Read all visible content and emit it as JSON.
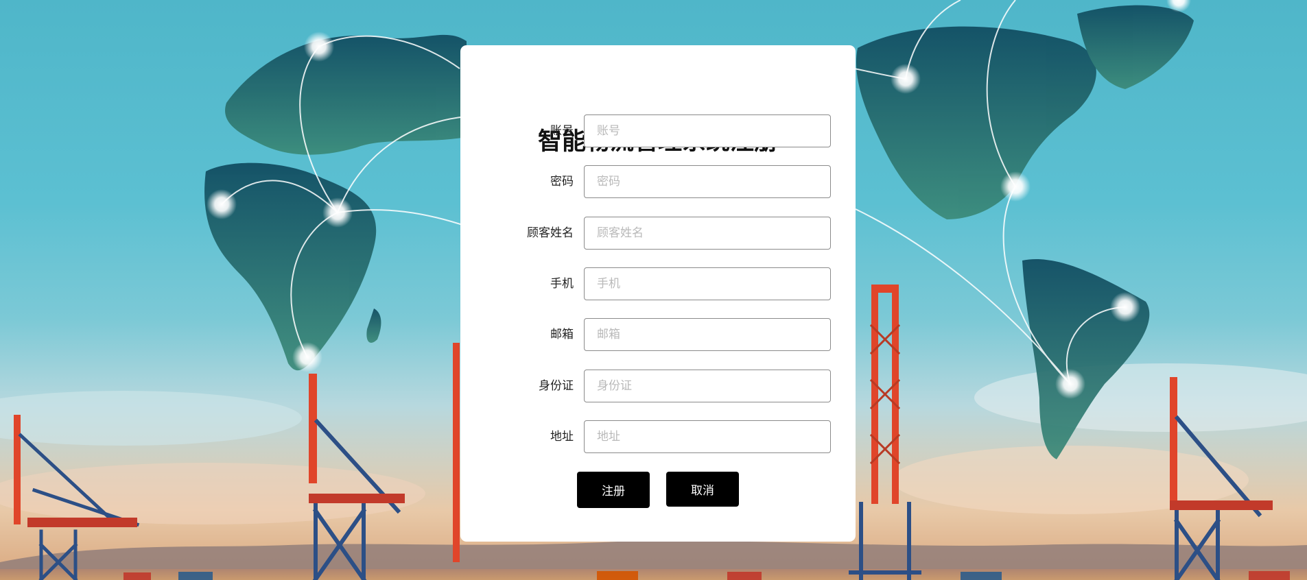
{
  "form": {
    "title": "智能物流管理系统注册",
    "fields": [
      {
        "label": "账号",
        "placeholder": "账号",
        "value": ""
      },
      {
        "label": "密码",
        "placeholder": "密码",
        "value": ""
      },
      {
        "label": "顾客姓名",
        "placeholder": "顾客姓名",
        "value": ""
      },
      {
        "label": "手机",
        "placeholder": "手机",
        "value": ""
      },
      {
        "label": "邮箱",
        "placeholder": "邮箱",
        "value": ""
      },
      {
        "label": "身份证",
        "placeholder": "身份证",
        "value": ""
      },
      {
        "label": "地址",
        "placeholder": "地址",
        "value": ""
      }
    ],
    "register_label": "注册",
    "cancel_label": "取消"
  },
  "colors": {
    "button_bg": "#000000",
    "panel_bg": "#ffffff",
    "sky": "#5cc0d2",
    "crane": "#e0452a"
  }
}
